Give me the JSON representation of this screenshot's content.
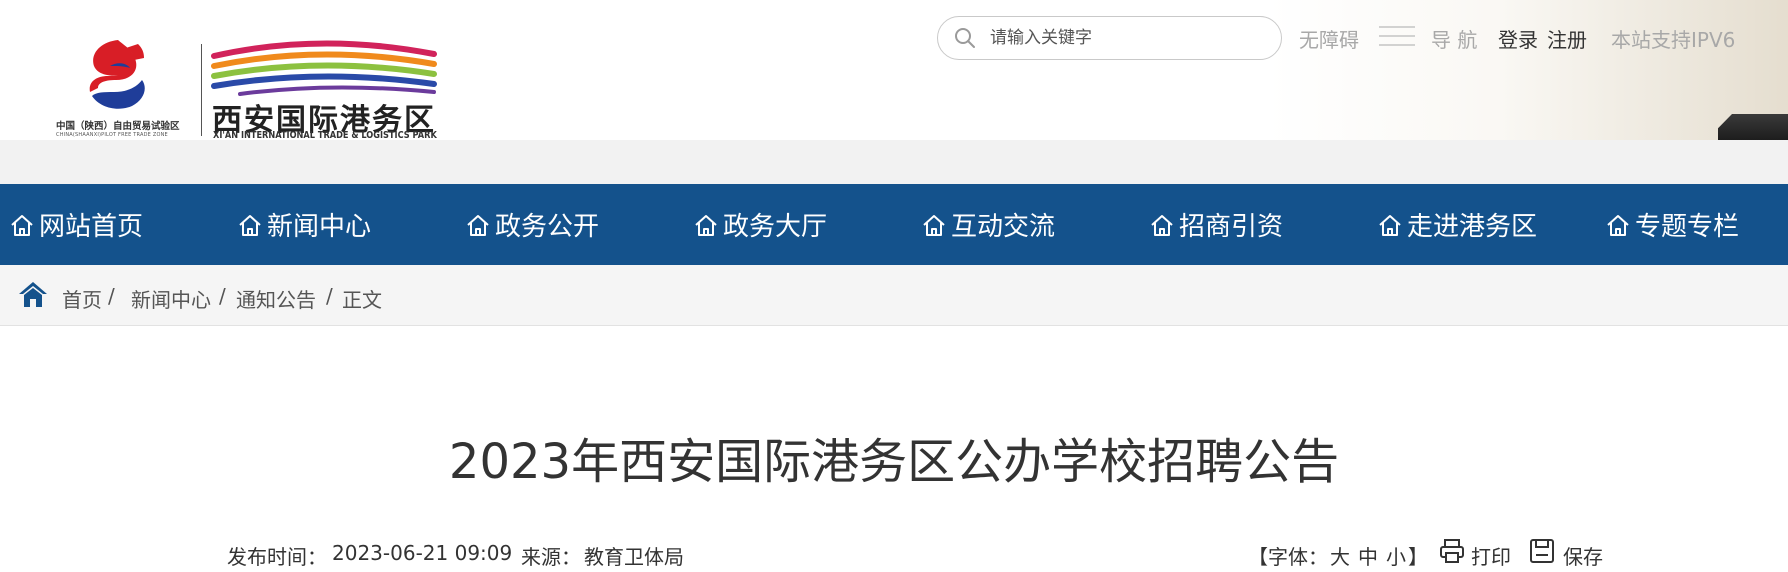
{
  "logo": {
    "name": "西安国际港务区",
    "name_en": "XI'AN INTERNATIONAL TRADE & LOGISTICS PARK",
    "zone_cn": "中国（陕西）自由贸易试验区",
    "zone_en": "CHINA(SHAANXI)PILOT FREE TRADE ZONE"
  },
  "search": {
    "placeholder": "请输入关键字",
    "value": ""
  },
  "toolbar": {
    "accessibility": "无障碍",
    "nav_label": "导 航",
    "login": "登录",
    "register": "注册",
    "ipv6": "本站支持IPV6"
  },
  "nav": {
    "items": [
      {
        "label": "网站首页"
      },
      {
        "label": "新闻中心"
      },
      {
        "label": "政务公开"
      },
      {
        "label": "政务大厅"
      },
      {
        "label": "互动交流"
      },
      {
        "label": "招商引资"
      },
      {
        "label": "走进港务区"
      },
      {
        "label": "专题专栏"
      }
    ]
  },
  "breadcrumb": {
    "items": [
      "首页",
      "新闻中心",
      "通知公告",
      "正文"
    ],
    "separator": "/"
  },
  "article": {
    "title": "2023年西安国际港务区公办学校招聘公告",
    "publish_label": "发布时间：",
    "publish_time": "2023-06-21 09:09",
    "source_label": "来源：",
    "source": "教育卫体局"
  },
  "article_tools": {
    "font_open": "【字体：",
    "font_large": "大",
    "font_medium": "中",
    "font_small": "小",
    "font_close": "】",
    "print": "打印",
    "save": "保存"
  },
  "colors": {
    "nav_bg": "#14528c",
    "breadcrumb_bg": "#f5f5f5",
    "logo_red": "#d81e26",
    "logo_blue": "#1f3d99"
  }
}
